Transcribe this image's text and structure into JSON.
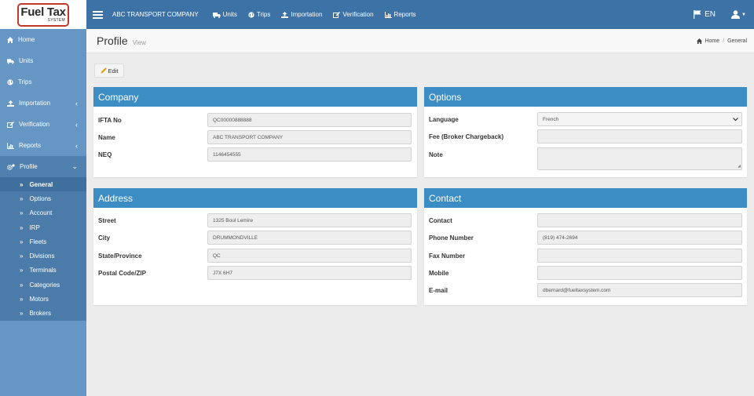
{
  "logo": {
    "main": "Fuel Tax",
    "sub": "SYSTEM"
  },
  "topbar": {
    "company": "ABC TRANSPORT COMPANY",
    "nav": [
      {
        "label": "Units",
        "icon": "truck-icon"
      },
      {
        "label": "Trips",
        "icon": "globe-icon"
      },
      {
        "label": "Importation",
        "icon": "upload-icon"
      },
      {
        "label": "Verification",
        "icon": "edit-icon"
      },
      {
        "label": "Reports",
        "icon": "bar-chart-icon"
      }
    ],
    "language": "EN"
  },
  "sidebar": {
    "items": [
      {
        "label": "Home",
        "icon": "home-icon"
      },
      {
        "label": "Units",
        "icon": "truck-icon"
      },
      {
        "label": "Trips",
        "icon": "globe-icon"
      },
      {
        "label": "Importation",
        "icon": "upload-icon",
        "chevron": "‹"
      },
      {
        "label": "Verification",
        "icon": "edit-icon",
        "chevron": "‹"
      },
      {
        "label": "Reports",
        "icon": "bar-chart-icon",
        "chevron": "‹"
      },
      {
        "label": "Profile",
        "icon": "gears-icon",
        "chevron": "⌄"
      }
    ],
    "submenu": [
      "General",
      "Options",
      "Account",
      "IRP",
      "Fleets",
      "Divisions",
      "Terminals",
      "Categories",
      "Motors",
      "Brokers"
    ]
  },
  "header": {
    "title": "Profile",
    "subtitle": "View",
    "breadcrumb": {
      "home": "Home",
      "current": "General"
    }
  },
  "edit_label": "Edit",
  "company": {
    "title": "Company",
    "fields": [
      {
        "label": "IFTA No",
        "value": "QC00000888888"
      },
      {
        "label": "Name",
        "value": "ABC TRANSPORT COMPANY"
      },
      {
        "label": "NEQ",
        "value": "1146454555"
      }
    ]
  },
  "options": {
    "title": "Options",
    "fields": [
      {
        "label": "Language",
        "value": "French"
      },
      {
        "label": "Fee (Broker Chargeback)",
        "value": ""
      },
      {
        "label": "Note",
        "value": ""
      }
    ]
  },
  "address": {
    "title": "Address",
    "fields": [
      {
        "label": "Street",
        "value": "1325 Boul Lemire"
      },
      {
        "label": "City",
        "value": "DRUMMONDVILLE"
      },
      {
        "label": "State/Province",
        "value": "QC"
      },
      {
        "label": "Postal Code/ZIP",
        "value": "J7X 6H7"
      }
    ]
  },
  "contact": {
    "title": "Contact",
    "fields": [
      {
        "label": "Contact",
        "value": ""
      },
      {
        "label": "Phone Number",
        "value": "(819) 474-2694"
      },
      {
        "label": "Fax Number",
        "value": ""
      },
      {
        "label": "Mobile",
        "value": ""
      },
      {
        "label": "E-mail",
        "value": "dbernard@fueltaxsystem.com"
      }
    ]
  },
  "colors": {
    "topbar": "#3c72a6",
    "sidebar": "#6596c4",
    "panel_header": "#3c8dc4",
    "logo_border": "#c0392b"
  }
}
